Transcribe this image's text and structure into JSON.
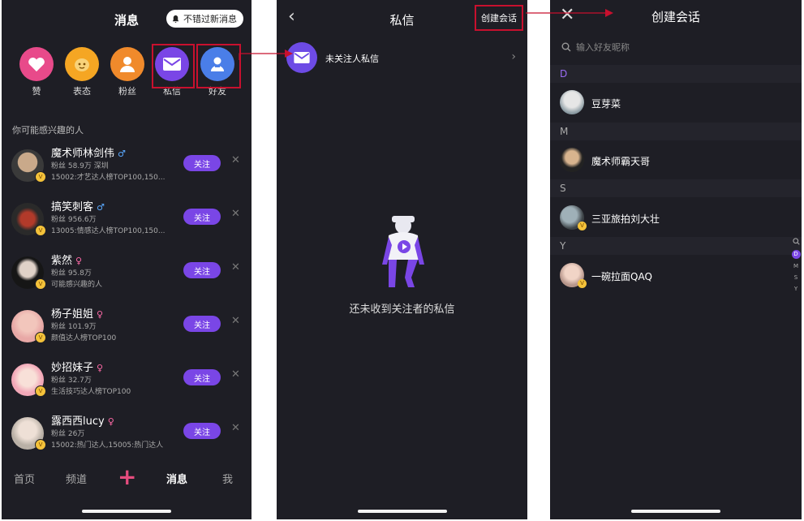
{
  "accent": "#7a46e6",
  "highlight_color": "#c8102e",
  "screen1": {
    "title": "消息",
    "tip": "不错过新消息",
    "categories": [
      {
        "label": "赞",
        "color": "#e84a8a",
        "icon": "heart-icon"
      },
      {
        "label": "表态",
        "color": "#f5a623",
        "icon": "emoji-icon"
      },
      {
        "label": "粉丝",
        "color": "#f08a2b",
        "icon": "person-icon"
      },
      {
        "label": "私信",
        "color": "#7a46e6",
        "icon": "mail-icon"
      },
      {
        "label": "好友",
        "color": "#4a7ee8",
        "icon": "friend-icon"
      }
    ],
    "section_title": "你可能感兴趣的人",
    "follow_label": "关注",
    "users": [
      {
        "name": "魔术师林剑伟",
        "sex": "♂",
        "meta1": "粉丝 58.9万   深圳",
        "meta2": "15002:才艺达人榜TOP100,150..."
      },
      {
        "name": "搞笑刺客",
        "sex": "♂",
        "meta1": "粉丝 956.6万",
        "meta2": "13005:情感达人榜TOP100,150..."
      },
      {
        "name": "紫然",
        "sex": "♀",
        "meta1": "粉丝 95.8万",
        "meta2": "可能感兴趣的人"
      },
      {
        "name": "杨子姐姐",
        "sex": "♀",
        "meta1": "粉丝 101.9万",
        "meta2": "颜值达人榜TOP100"
      },
      {
        "name": "妙招妹子",
        "sex": "♀",
        "meta1": "粉丝 32.7万",
        "meta2": "生活技巧达人榜TOP100"
      },
      {
        "name": "露西西lucy",
        "sex": "♀",
        "meta1": "粉丝 26万",
        "meta2": "15002:热门达人,15005:热门达人"
      }
    ],
    "nav": [
      "首页",
      "频道",
      "消息",
      "我"
    ]
  },
  "screen2": {
    "title": "私信",
    "create_label": "创建会话",
    "row_label": "未关注人私信",
    "empty_text": "还未收到关注者的私信"
  },
  "screen3": {
    "title": "创建会话",
    "search_placeholder": "输入好友昵称",
    "groups": [
      {
        "letter": "D",
        "name": "豆芽菜"
      },
      {
        "letter": "M",
        "name": "魔术师霸天哥"
      },
      {
        "letter": "S",
        "name": "三亚旅拍刘大壮"
      },
      {
        "letter": "Y",
        "name": "一碗拉面QAQ"
      }
    ],
    "index": [
      "D",
      "M",
      "S",
      "Y"
    ]
  }
}
